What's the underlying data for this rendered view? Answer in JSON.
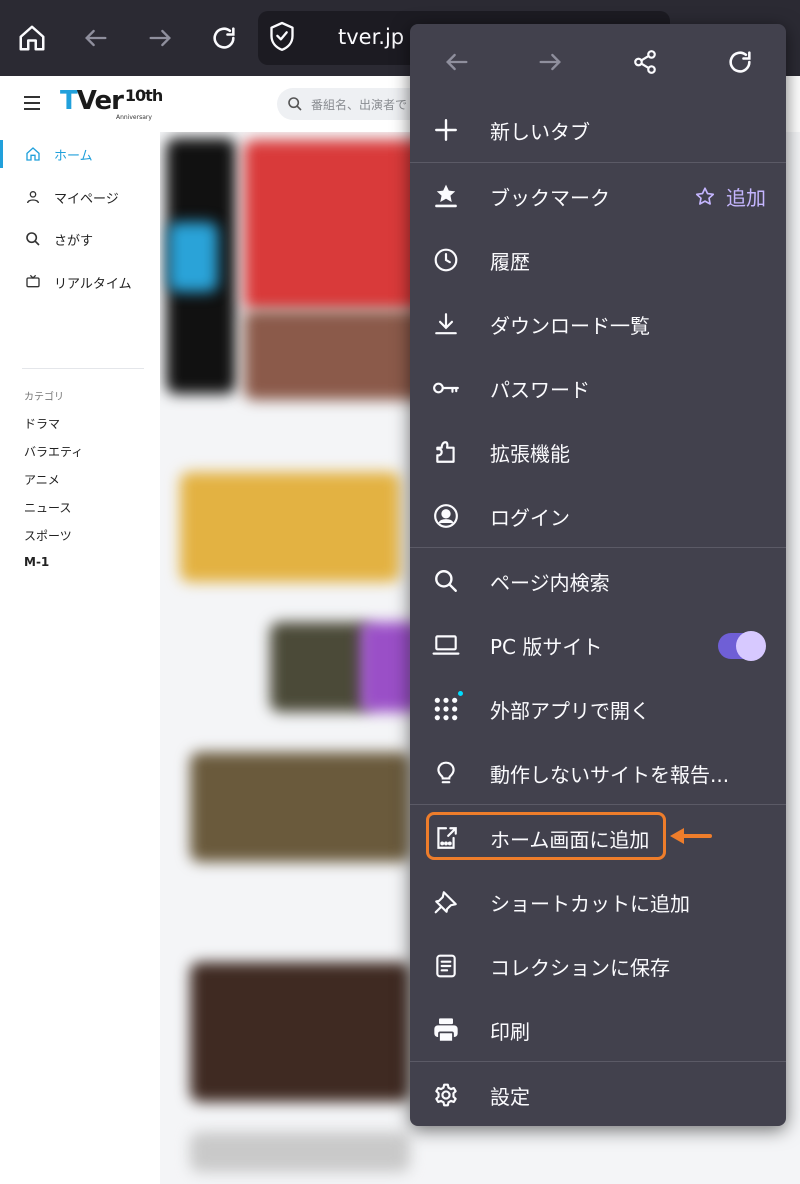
{
  "browser": {
    "url": "tver.jp"
  },
  "page": {
    "logo": {
      "brand_t": "T",
      "brand_rest": "Ver",
      "anniversary": "10th",
      "anniversary_sub": "Anniversary"
    },
    "search_placeholder": "番組名、出演者で",
    "nav": [
      {
        "label": "ホーム",
        "icon": "home-icon",
        "active": true
      },
      {
        "label": "マイページ",
        "icon": "person-icon",
        "active": false
      },
      {
        "label": "さがす",
        "icon": "search-icon",
        "active": false
      },
      {
        "label": "リアルタイム",
        "icon": "tv-icon",
        "active": false
      }
    ],
    "category_heading": "カテゴリ",
    "categories": [
      "ドラマ",
      "バラエティ",
      "アニメ",
      "ニュース",
      "スポーツ",
      "M-1"
    ]
  },
  "menu": {
    "items": [
      {
        "label": "新しいタブ",
        "icon": "plus-icon"
      },
      {
        "label": "ブックマーク",
        "icon": "bookmark-star-icon",
        "action": "追加"
      },
      {
        "label": "履歴",
        "icon": "clock-icon"
      },
      {
        "label": "ダウンロード一覧",
        "icon": "download-icon"
      },
      {
        "label": "パスワード",
        "icon": "key-icon"
      },
      {
        "label": "拡張機能",
        "icon": "puzzle-icon"
      },
      {
        "label": "ログイン",
        "icon": "account-icon"
      },
      {
        "label": "ページ内検索",
        "icon": "search-icon"
      },
      {
        "label": "PC 版サイト",
        "icon": "laptop-icon",
        "toggle_on": true
      },
      {
        "label": "外部アプリで開く",
        "icon": "apps-grid-icon"
      },
      {
        "label": "動作しないサイトを報告...",
        "icon": "lightbulb-icon"
      },
      {
        "label": "ホーム画面に追加",
        "icon": "add-to-home-icon"
      },
      {
        "label": "ショートカットに追加",
        "icon": "pin-icon"
      },
      {
        "label": "コレクションに保存",
        "icon": "collection-icon"
      },
      {
        "label": "印刷",
        "icon": "print-icon"
      },
      {
        "label": "設定",
        "icon": "gear-icon"
      }
    ]
  },
  "colors": {
    "toolbar_bg": "#2b2a33",
    "menu_bg": "#42414d",
    "accent_purple": "#c5b6ff",
    "highlight_orange": "#ee7d2b",
    "tver_blue": "#21a0db"
  }
}
